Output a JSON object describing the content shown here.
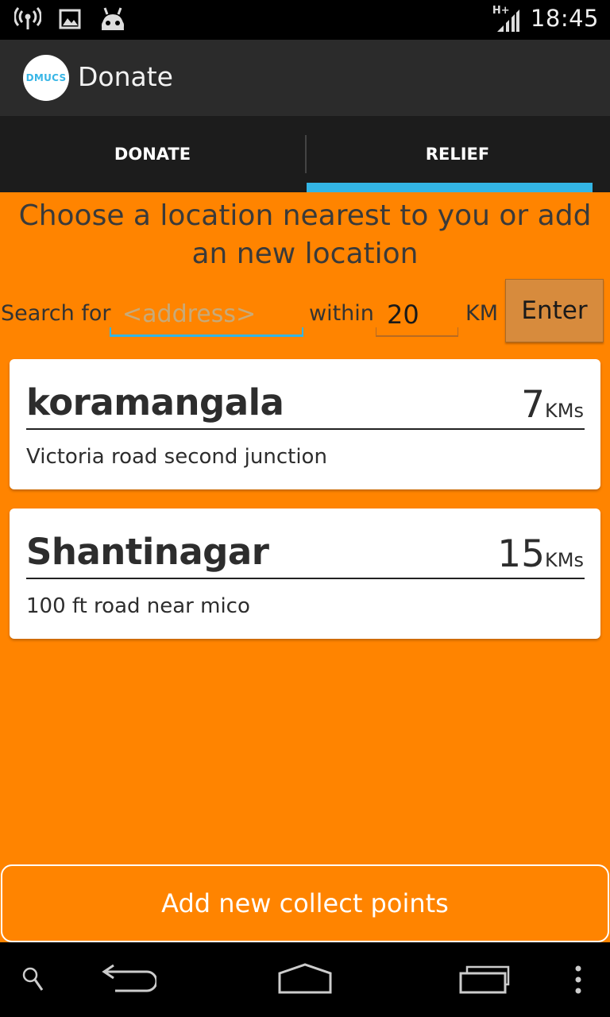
{
  "status_bar": {
    "time": "18:45",
    "network": "H+"
  },
  "action_bar": {
    "logo_text": "DMUCS",
    "title": "Donate"
  },
  "tabs": [
    {
      "label": "DONATE",
      "selected": false
    },
    {
      "label": "RELIEF",
      "selected": true
    }
  ],
  "heading": "Choose a location nearest to you or add an new location",
  "search": {
    "search_for_label": "Search for",
    "address_placeholder": "<address>",
    "within_label": "within",
    "distance_value": "20",
    "unit_label": "KM",
    "enter_label": "Enter"
  },
  "locations": [
    {
      "name": "koramangala",
      "distance": "7",
      "unit": "KMs",
      "address": "Victoria road second junction"
    },
    {
      "name": "Shantinagar",
      "distance": "15",
      "unit": "KMs",
      "address": "100 ft road near mico"
    }
  ],
  "add_button": "Add new collect points",
  "colors": {
    "background": "#ff8400",
    "accent": "#33b5e5",
    "action_bar": "#2b2b2b",
    "tab_bar": "#1c1c1c"
  },
  "icons": {
    "status_left": [
      "wireless-signal-icon",
      "picture-icon",
      "android-robot-icon"
    ],
    "status_right": [
      "cell-signal-icon"
    ],
    "nav": [
      "search-icon",
      "back-icon",
      "home-icon",
      "recent-apps-icon",
      "overflow-menu-icon"
    ]
  }
}
